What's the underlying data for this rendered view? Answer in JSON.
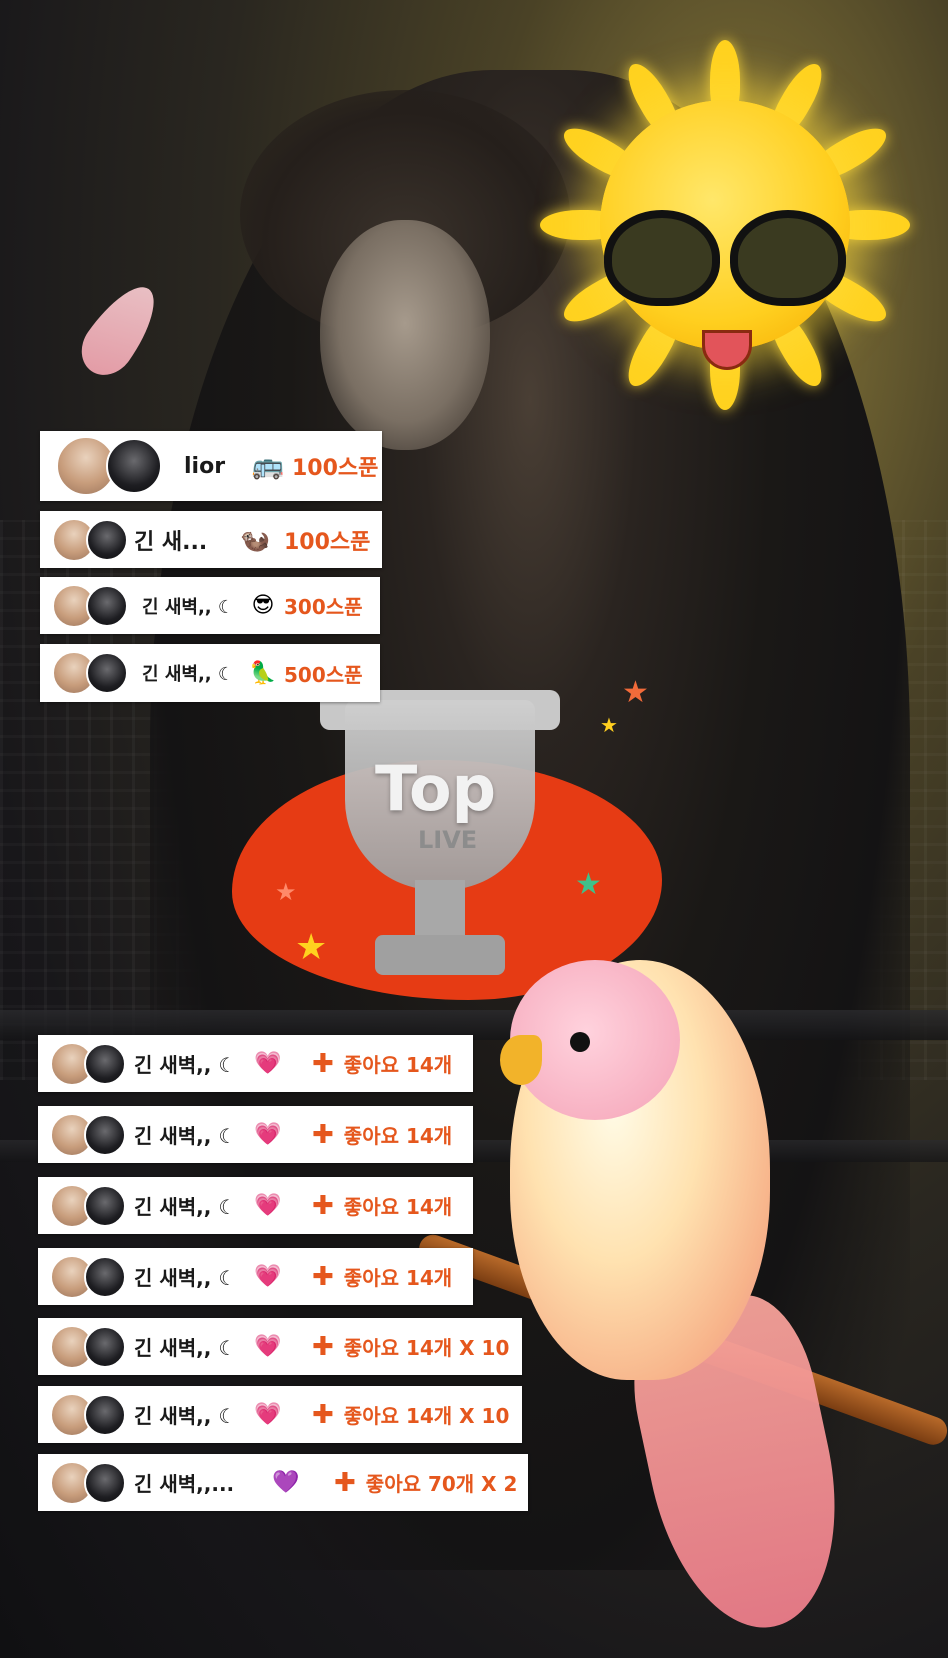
{
  "spoon_gifts": [
    {
      "nickname": "lior",
      "gift_icon": "bus-sticker-icon",
      "amount": "100스푼"
    },
    {
      "nickname": "긴 새...",
      "gift_icon": "otter-sticker-icon",
      "amount": "100스푼"
    },
    {
      "nickname": "긴 새벽,, ☾",
      "gift_icon": "sunglasses-sun-icon",
      "amount": "300스푼"
    },
    {
      "nickname": "긴 새벽,, ☾",
      "gift_icon": "parrot-sticker-icon",
      "amount": "500스푼"
    }
  ],
  "like_gifts": [
    {
      "nickname": "긴 새벽,, ☾",
      "gift_icon": "heart-sticker-icon",
      "like_text": "좋아요 14개"
    },
    {
      "nickname": "긴 새벽,, ☾",
      "gift_icon": "heart-sticker-icon",
      "like_text": "좋아요 14개"
    },
    {
      "nickname": "긴 새벽,, ☾",
      "gift_icon": "heart-sticker-icon",
      "like_text": "좋아요 14개"
    },
    {
      "nickname": "긴 새벽,, ☾",
      "gift_icon": "heart-sticker-icon",
      "like_text": "좋아요 14개"
    },
    {
      "nickname": "긴 새벽,, ☾",
      "gift_icon": "heart-sticker-icon",
      "like_text": "좋아요 14개 X 10"
    },
    {
      "nickname": "긴 새벽,, ☾",
      "gift_icon": "heart-sticker-icon",
      "like_text": "좋아요 14개 X 10"
    },
    {
      "nickname": "긴 새벽,,...",
      "gift_icon": "purple-heart-sticker-icon",
      "like_text": "좋아요 70개 X 2"
    }
  ],
  "trophy": {
    "title": "Top",
    "subtitle": "LIVE"
  },
  "colors": {
    "accent": "#e5571d",
    "card_bg": "#ffffff",
    "trophy_blob": "#e63b14",
    "sun": "#ffcf1f"
  },
  "icons": {
    "like": "plus-badge-icon"
  }
}
